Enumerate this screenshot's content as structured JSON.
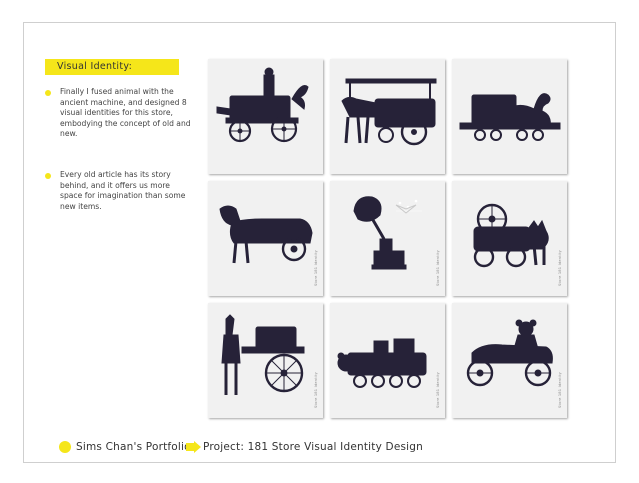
{
  "section": {
    "heading": "Visual Identity:",
    "bullets": [
      "Finally I fused animal with the ancient machine, and designed 8 visual identities for this store, embodying the concept of old and new.",
      "Every old article has its story behind, and it offers us more space for imagination than some new items."
    ]
  },
  "gallery": {
    "card_mark": "Store 181 Identity",
    "cards": [
      {
        "subject": "wagon with rooster and figures"
      },
      {
        "subject": "horse carriage car"
      },
      {
        "subject": "duck steam locomotive"
      },
      {
        "subject": "dachshund vintage car"
      },
      {
        "subject": "gramophone with bird"
      },
      {
        "subject": "cat steam engine"
      },
      {
        "subject": "alpaca cart"
      },
      {
        "subject": "bear locomotive"
      },
      {
        "subject": "teddy bear vintage car"
      }
    ]
  },
  "footer": {
    "portfolio": "Sims Chan's Portfolio",
    "project": "Project: 181 Store Visual Identity Design"
  },
  "colors": {
    "accent": "#f5e61a",
    "ink": "#262238",
    "card": "#f1f1f1"
  }
}
